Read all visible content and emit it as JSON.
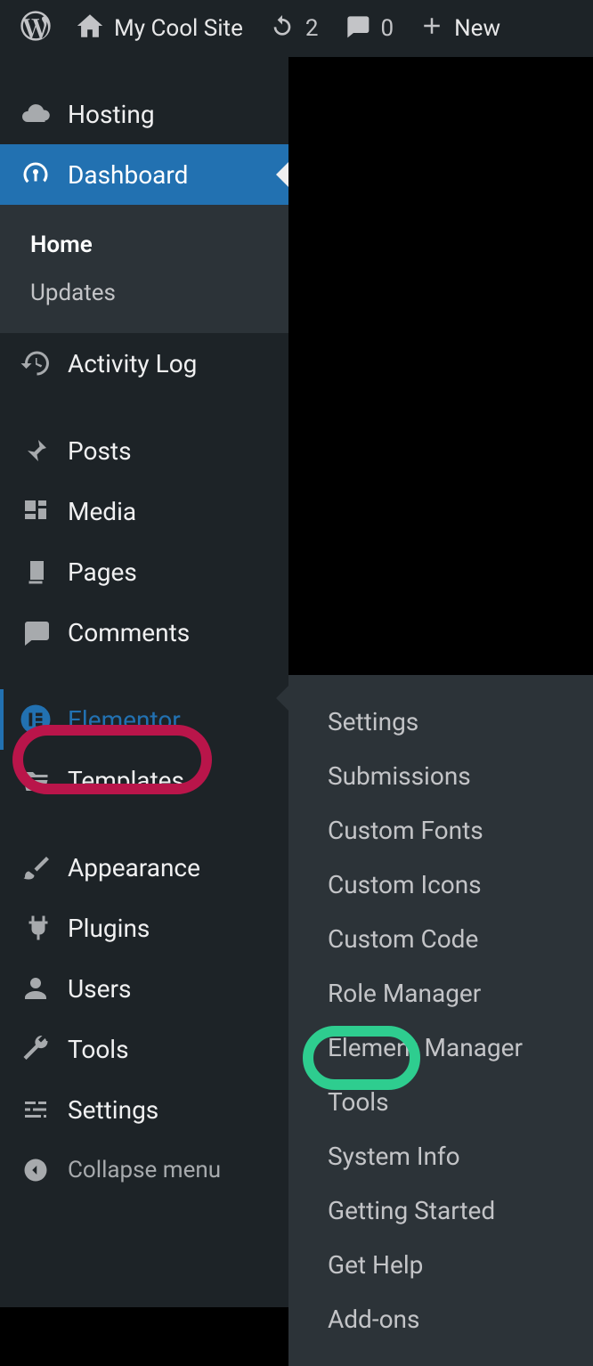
{
  "adminbar": {
    "site_name": "My Cool Site",
    "updates_count": "2",
    "comments_count": "0",
    "new_label": "New"
  },
  "sidebar": {
    "hosting": "Hosting",
    "dashboard": "Dashboard",
    "dashboard_sub": {
      "home": "Home",
      "updates": "Updates"
    },
    "activity_log": "Activity Log",
    "posts": "Posts",
    "media": "Media",
    "pages": "Pages",
    "comments": "Comments",
    "elementor": "Elementor",
    "templates": "Templates",
    "appearance": "Appearance",
    "plugins": "Plugins",
    "users": "Users",
    "tools": "Tools",
    "settings": "Settings",
    "collapse": "Collapse menu"
  },
  "flyout": {
    "settings": "Settings",
    "submissions": "Submissions",
    "custom_fonts": "Custom Fonts",
    "custom_icons": "Custom Icons",
    "custom_code": "Custom Code",
    "role_manager": "Role Manager",
    "element_manager": "Element Manager",
    "tools": "Tools",
    "system_info": "System Info",
    "getting_started": "Getting Started",
    "get_help": "Get Help",
    "addons": "Add-ons"
  }
}
